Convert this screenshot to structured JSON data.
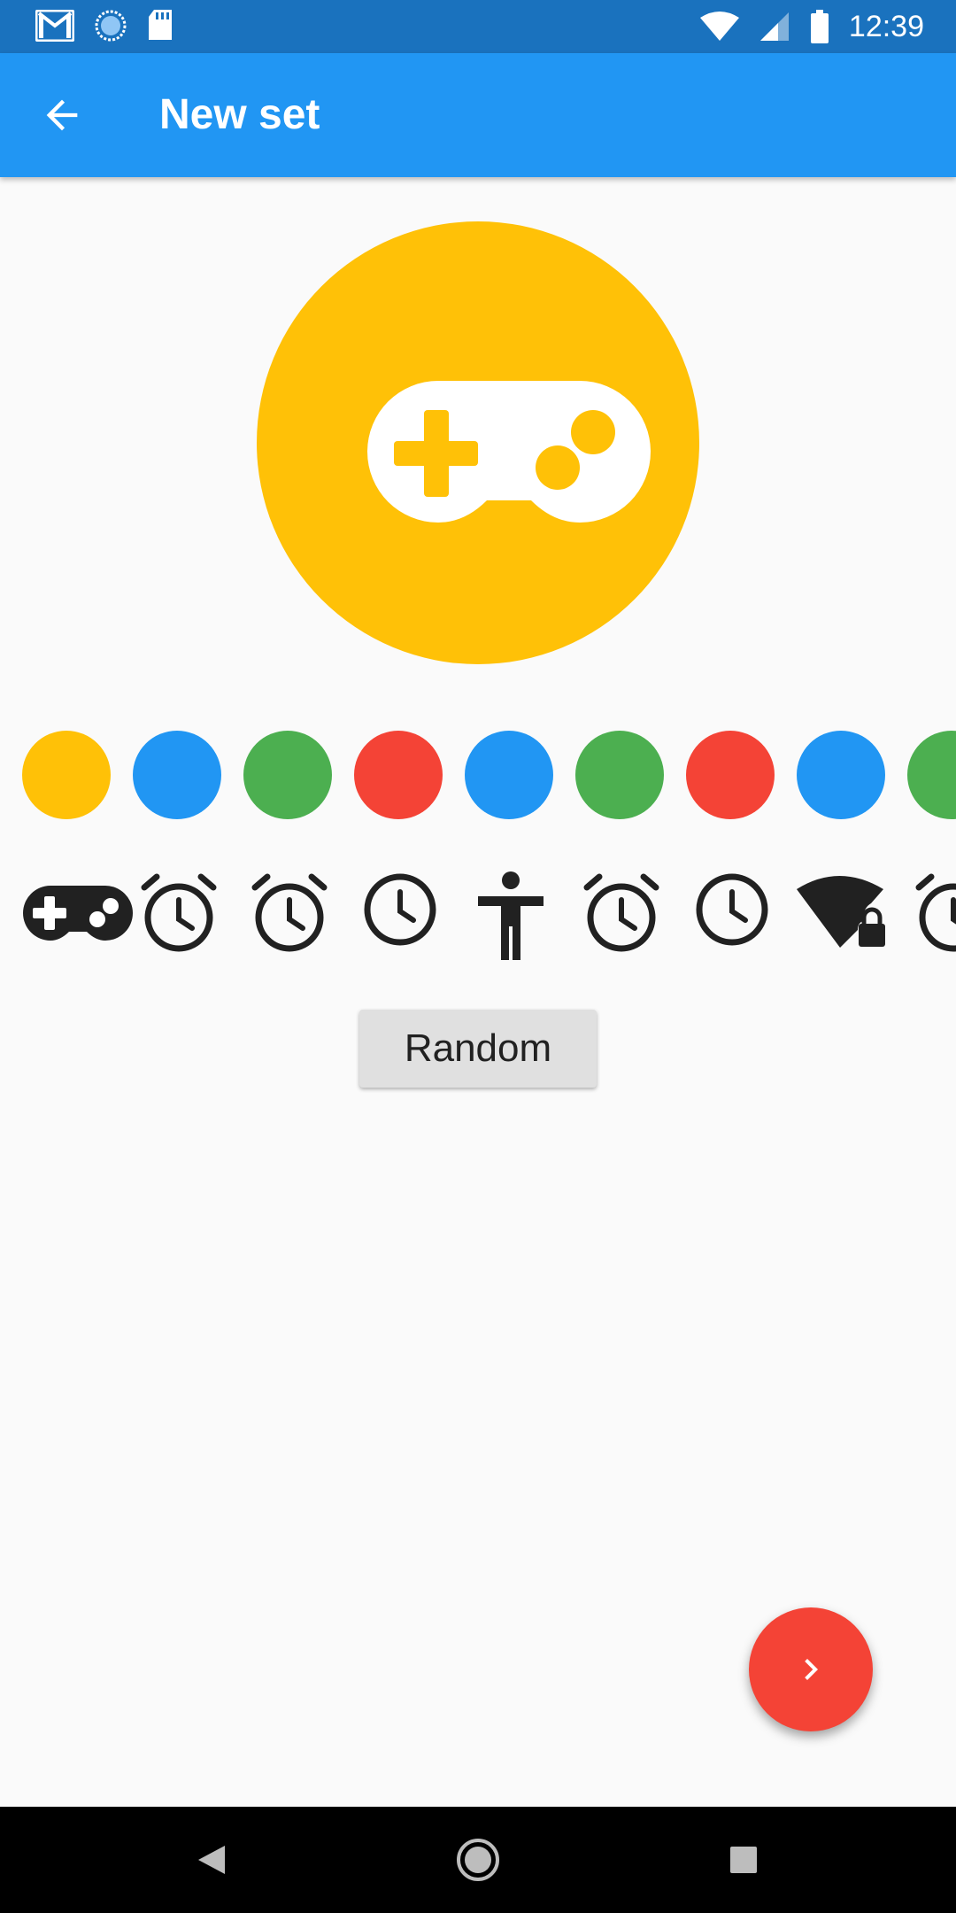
{
  "status_bar": {
    "time": "12:39",
    "left_icons": [
      "gmail-icon",
      "sync-icon",
      "sd-card-icon"
    ],
    "right_icons": [
      "wifi-icon",
      "signal-icon",
      "battery-icon"
    ]
  },
  "app_bar": {
    "title": "New set",
    "back_icon": "arrow-back-icon"
  },
  "preview": {
    "color": "#FFC107",
    "icon": "gamepad-icon"
  },
  "colors": [
    "#FFC107",
    "#2196F3",
    "#4CAF50",
    "#F44336",
    "#2196F3",
    "#4CAF50",
    "#F44336",
    "#2196F3",
    "#4CAF50"
  ],
  "icons": [
    "gamepad-icon",
    "alarm-icon",
    "alarm-icon",
    "clock-icon",
    "accessibility-icon",
    "alarm-icon",
    "clock-icon",
    "wifi-lock-icon",
    "alarm-icon"
  ],
  "random_button": {
    "label": "Random"
  },
  "fab": {
    "icon": "chevron-right-icon",
    "color": "#F44336"
  },
  "nav_bar": {
    "buttons": [
      "back-triangle-icon",
      "home-circle-icon",
      "recents-square-icon"
    ]
  }
}
